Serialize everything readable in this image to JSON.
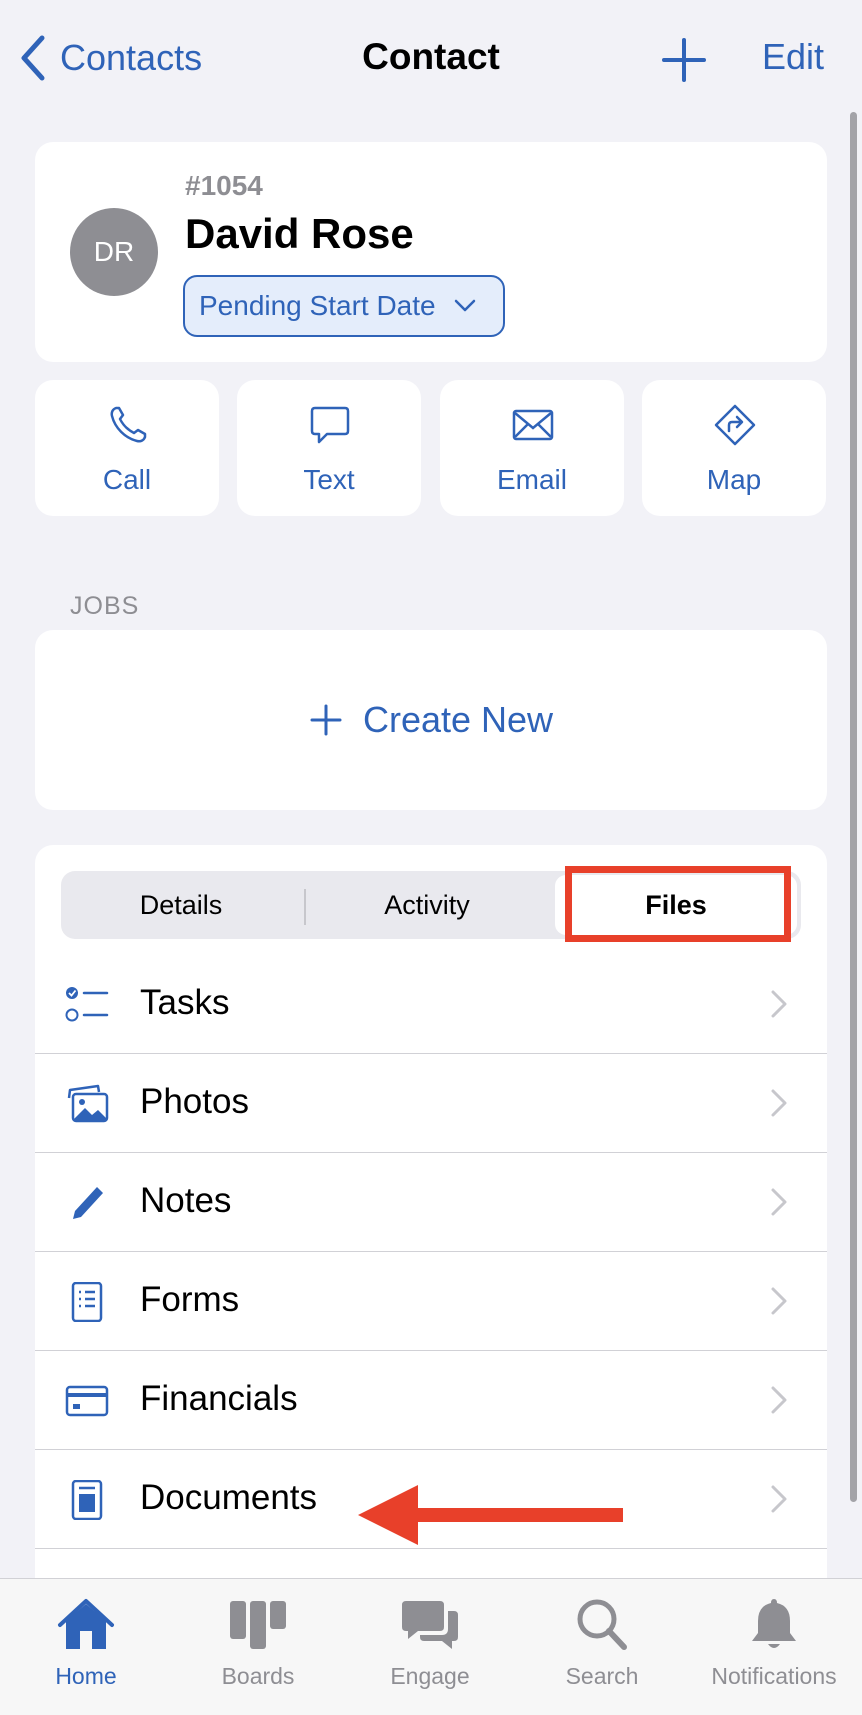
{
  "nav": {
    "back_label": "Contacts",
    "title": "Contact",
    "edit_label": "Edit"
  },
  "contact": {
    "initials": "DR",
    "id": "#1054",
    "name": "David Rose",
    "status": "Pending Start Date"
  },
  "actions": [
    {
      "label": "Call",
      "icon": "phone-icon"
    },
    {
      "label": "Text",
      "icon": "message-icon"
    },
    {
      "label": "Email",
      "icon": "envelope-icon"
    },
    {
      "label": "Map",
      "icon": "directions-icon"
    }
  ],
  "jobs": {
    "section_label": "JOBS",
    "create_label": "Create New"
  },
  "segments": {
    "items": [
      "Details",
      "Activity",
      "Files"
    ],
    "selected": "Files"
  },
  "file_rows": [
    {
      "label": "Tasks",
      "icon": "tasks-icon"
    },
    {
      "label": "Photos",
      "icon": "photos-icon"
    },
    {
      "label": "Notes",
      "icon": "pencil-icon"
    },
    {
      "label": "Forms",
      "icon": "form-icon"
    },
    {
      "label": "Financials",
      "icon": "credit-card-icon"
    },
    {
      "label": "Documents",
      "icon": "document-icon"
    }
  ],
  "tabbar": {
    "items": [
      {
        "label": "Home",
        "icon": "home-icon",
        "active": true
      },
      {
        "label": "Boards",
        "icon": "boards-icon",
        "active": false
      },
      {
        "label": "Engage",
        "icon": "chat-bubbles-icon",
        "active": false
      },
      {
        "label": "Search",
        "icon": "magnifier-icon",
        "active": false
      },
      {
        "label": "Notifications",
        "icon": "bell-icon",
        "active": false
      }
    ]
  },
  "colors": {
    "accent": "#2f63b8",
    "annotation": "#e8402a",
    "background": "#f2f2f7"
  }
}
